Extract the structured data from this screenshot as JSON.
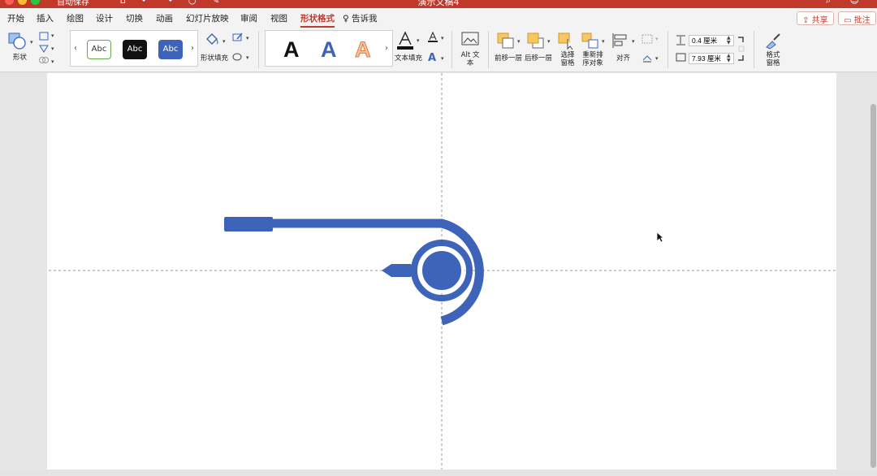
{
  "app": {
    "title": "演示文稿4",
    "autosave_label": "自动保存",
    "accent_color": "#c0392b",
    "shape_color": "#3d64b8"
  },
  "menu": {
    "tabs": [
      "开始",
      "插入",
      "绘图",
      "设计",
      "切换",
      "动画",
      "幻灯片放映",
      "审阅",
      "视图",
      "形状格式"
    ],
    "active_tab": "形状格式",
    "tell_me": "告诉我",
    "share": "共享",
    "comments": "批注"
  },
  "ribbon": {
    "shapes_label": "形状",
    "style_samples": [
      "Abc",
      "Abc",
      "Abc"
    ],
    "shape_fill_label": "形状填充",
    "wordart_samples": [
      "A",
      "A",
      "A"
    ],
    "text_fill_label": "文本填充",
    "alt_text_label": "Alt 文本",
    "bring_forward_label": "前移一层",
    "send_backward_label": "后移一层",
    "selection_pane_label": "选择 窗格",
    "reorder_label": "重新排 序对象",
    "align_label": "对齐",
    "height_value": "0.4 厘米",
    "width_value": "7.93 厘米",
    "format_pane_label": "格式 窗格"
  }
}
